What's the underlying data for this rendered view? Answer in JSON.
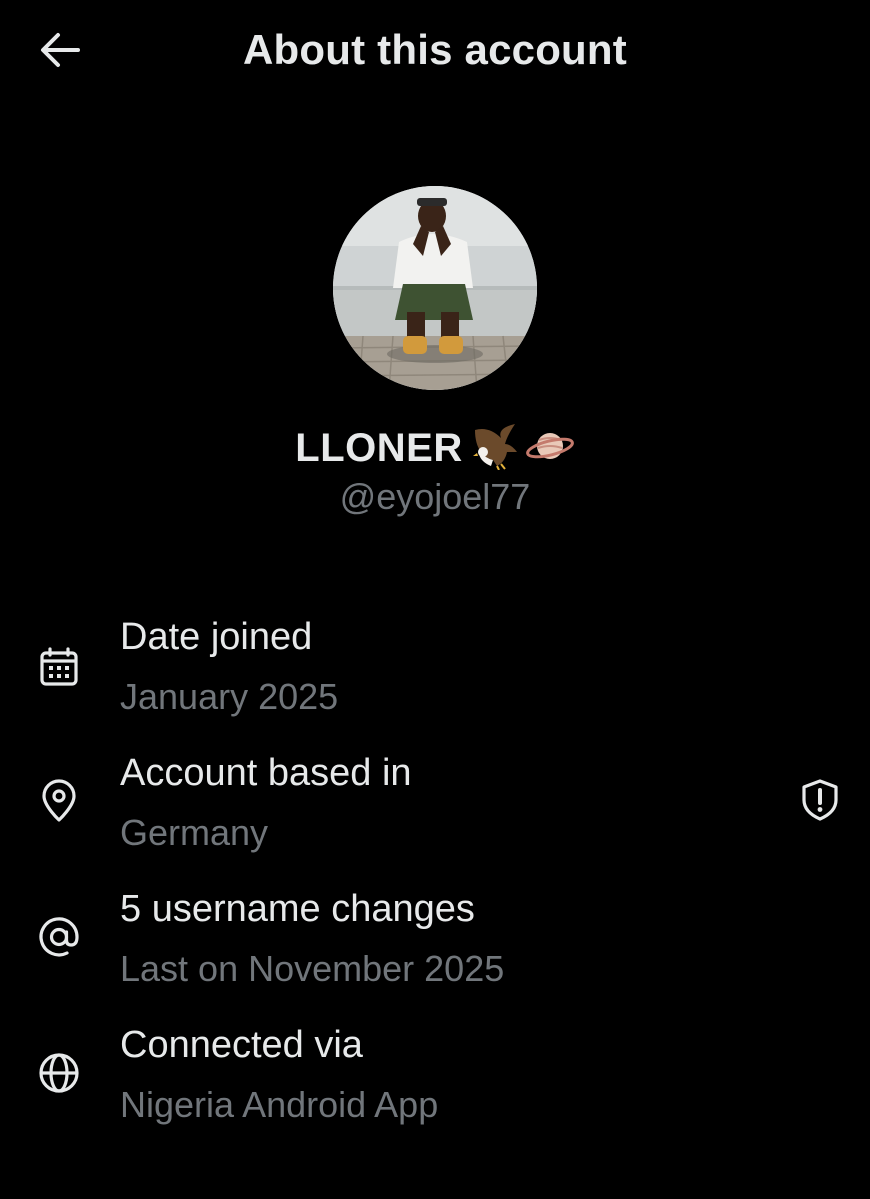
{
  "header": {
    "title": "About this account",
    "back_icon": "arrow-left-icon"
  },
  "profile": {
    "display_name": "LLONER",
    "name_emojis": [
      "eagle-emoji",
      "ringed-planet-emoji"
    ],
    "handle": "@eyojoel77",
    "avatar": "profile-photo"
  },
  "info": [
    {
      "icon": "calendar-icon",
      "title": "Date joined",
      "value": "January 2025"
    },
    {
      "icon": "location-pin-icon",
      "title": "Account based in",
      "value": "Germany",
      "action_icon": "shield-exclamation-icon"
    },
    {
      "icon": "at-sign-icon",
      "title": "5 username changes",
      "value": "Last on November 2025"
    },
    {
      "icon": "globe-icon",
      "title": "Connected via",
      "value": "Nigeria Android App"
    }
  ],
  "colors": {
    "background": "#000000",
    "primary_text": "#e7e9ea",
    "secondary_text": "#71767b"
  }
}
